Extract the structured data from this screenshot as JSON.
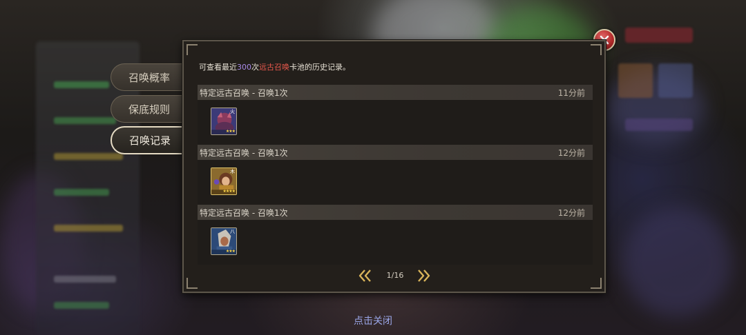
{
  "tabs": [
    {
      "label": "召唤概率",
      "active": false
    },
    {
      "label": "保底规则",
      "active": false
    },
    {
      "label": "召唤记录",
      "active": true
    }
  ],
  "panel": {
    "description": {
      "prefix": "可查看最近",
      "count": "300",
      "middle": "次",
      "pool": "远古召唤",
      "suffix": "卡池的历史记录。"
    },
    "records": [
      {
        "title": "特定远古召唤 - 召唤1次",
        "time": "11分前",
        "hero": {
          "icon": "hero-portrait-purple-beast",
          "stars": "★★★",
          "mark": "火"
        }
      },
      {
        "title": "特定远古召唤 - 召唤1次",
        "time": "12分前",
        "hero": {
          "icon": "hero-portrait-gold-warrior",
          "stars": "★★★★",
          "mark": "木"
        }
      },
      {
        "title": "特定远古召唤 - 召唤1次",
        "time": "12分前",
        "hero": {
          "icon": "hero-portrait-blue-spearman",
          "stars": "★★★",
          "mark": "八"
        }
      }
    ],
    "pager": {
      "text": "1/16",
      "prev_icon": "double-chevron-left-icon",
      "next_icon": "double-chevron-right-icon"
    }
  },
  "close_icon": "close-icon",
  "tap_close_label": "点击关闭",
  "colors": {
    "accent_count": "#a98ae8",
    "accent_pool": "#e8584c",
    "close_button": "#c0302c",
    "pager_gold": "#d9b45a"
  }
}
